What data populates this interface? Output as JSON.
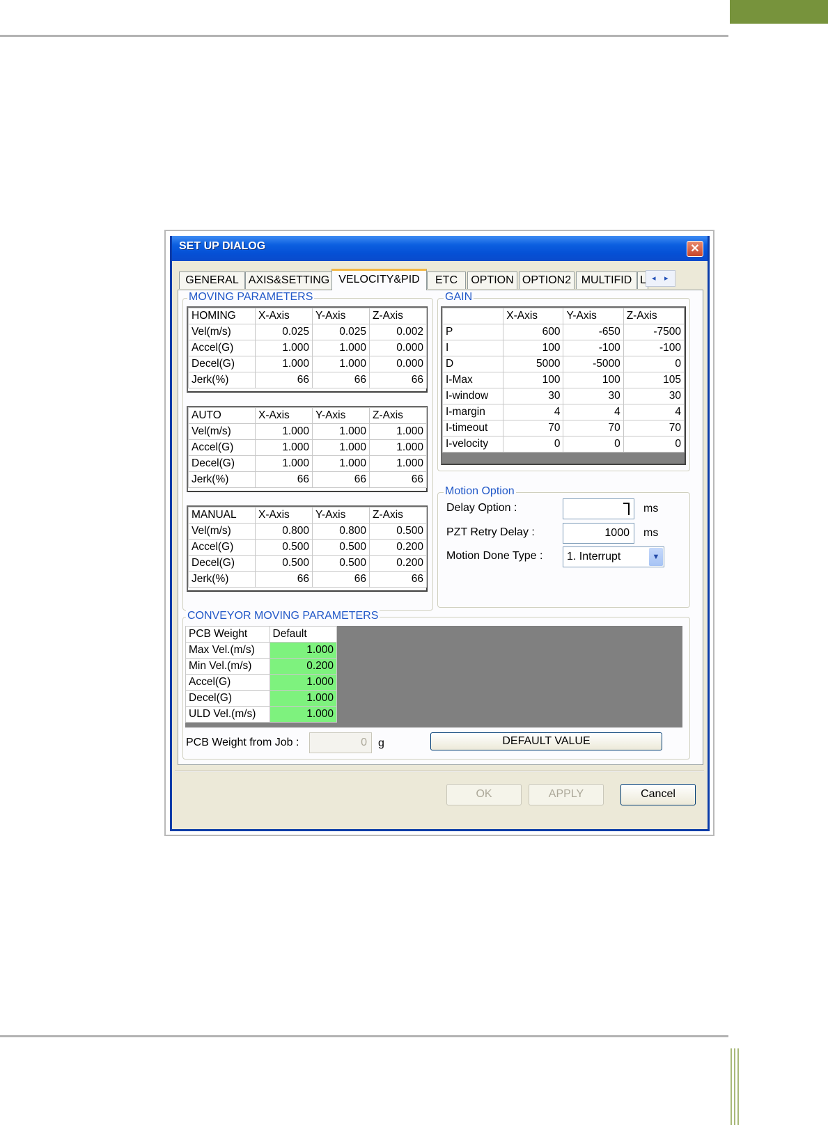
{
  "dialog": {
    "title": "SET UP DIALOG",
    "close_symbol": "✕"
  },
  "tabs": [
    "GENERAL",
    "AXIS&SETTING",
    "VELOCITY&PID",
    "ETC",
    "OPTION",
    "OPTION2",
    "MULTIFID",
    "L"
  ],
  "active_tab": "VELOCITY&PID",
  "tab_scroll": {
    "left": "◂",
    "right": "▸"
  },
  "moving_parameters": {
    "label": "MOVING PARAMETERS",
    "tables": [
      {
        "header": [
          "HOMING",
          "X-Axis",
          "Y-Axis",
          "Z-Axis"
        ],
        "rows": [
          [
            "Vel(m/s)",
            "0.025",
            "0.025",
            "0.002"
          ],
          [
            "Accel(G)",
            "1.000",
            "1.000",
            "0.000"
          ],
          [
            "Decel(G)",
            "1.000",
            "1.000",
            "0.000"
          ],
          [
            "Jerk(%)",
            "66",
            "66",
            "66"
          ]
        ]
      },
      {
        "header": [
          "AUTO",
          "X-Axis",
          "Y-Axis",
          "Z-Axis"
        ],
        "rows": [
          [
            "Vel(m/s)",
            "1.000",
            "1.000",
            "1.000"
          ],
          [
            "Accel(G)",
            "1.000",
            "1.000",
            "1.000"
          ],
          [
            "Decel(G)",
            "1.000",
            "1.000",
            "1.000"
          ],
          [
            "Jerk(%)",
            "66",
            "66",
            "66"
          ]
        ]
      },
      {
        "header": [
          "MANUAL",
          "X-Axis",
          "Y-Axis",
          "Z-Axis"
        ],
        "rows": [
          [
            "Vel(m/s)",
            "0.800",
            "0.800",
            "0.500"
          ],
          [
            "Accel(G)",
            "0.500",
            "0.500",
            "0.200"
          ],
          [
            "Decel(G)",
            "0.500",
            "0.500",
            "0.200"
          ],
          [
            "Jerk(%)",
            "66",
            "66",
            "66"
          ]
        ]
      }
    ]
  },
  "gain": {
    "label": "GAIN",
    "header": [
      "",
      "X-Axis",
      "Y-Axis",
      "Z-Axis"
    ],
    "rows": [
      [
        "P",
        "600",
        "-650",
        "-7500"
      ],
      [
        "I",
        "100",
        "-100",
        "-100"
      ],
      [
        "D",
        "5000",
        "-5000",
        "0"
      ],
      [
        "I-Max",
        "100",
        "100",
        "105"
      ],
      [
        "I-window",
        "30",
        "30",
        "30"
      ],
      [
        "I-margin",
        "4",
        "4",
        "4"
      ],
      [
        "I-timeout",
        "70",
        "70",
        "70"
      ],
      [
        "I-velocity",
        "0",
        "0",
        "0"
      ]
    ]
  },
  "motion_option": {
    "label": "Motion Option",
    "delay_option_label": "Delay Option :",
    "delay_option_value": "",
    "delay_unit": "ms",
    "pzt_retry_label": "PZT Retry Delay  :",
    "pzt_retry_value": "1000",
    "pzt_unit": "ms",
    "motion_done_label": "Motion Done Type :",
    "motion_done_value": "1. Interrupt"
  },
  "conveyor": {
    "label": "CONVEYOR MOVING PARAMETERS",
    "header": [
      "PCB Weight",
      "Default"
    ],
    "rows": [
      [
        "Max Vel.(m/s)",
        "1.000"
      ],
      [
        "Min Vel.(m/s)",
        "0.200"
      ],
      [
        "Accel(G)",
        "1.000"
      ],
      [
        "Decel(G)",
        "1.000"
      ],
      [
        "ULD Vel.(m/s)",
        "1.000"
      ]
    ],
    "value_cell_color": "#7ef27e",
    "pcb_weight_label": "PCB Weight from Job :",
    "pcb_weight_value": "0",
    "pcb_weight_unit": "g",
    "default_button": "DEFAULT VALUE"
  },
  "buttons": {
    "ok": "OK",
    "apply": "APPLY",
    "cancel": "Cancel"
  },
  "colors": {
    "title_bar": "#0a58dc",
    "group_label": "#2158c8",
    "page_accent": "#77933c"
  }
}
